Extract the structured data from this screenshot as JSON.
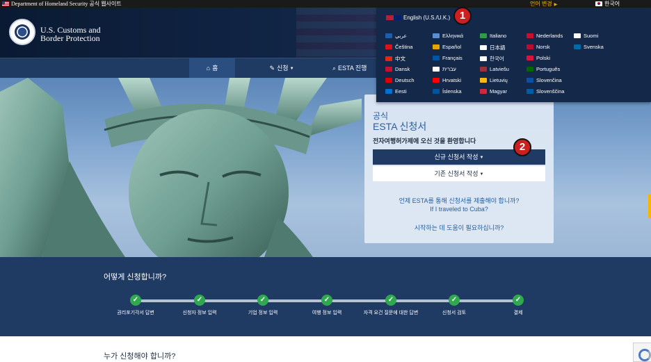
{
  "topbar": {
    "dhs_text": "Department of Homeland Security 공식 웹사이트",
    "language_change": "언어 변경",
    "current_language": "한국어"
  },
  "header": {
    "brand_line1": "U.S. Customs and",
    "brand_line2": "Border Protection"
  },
  "nav": {
    "home": "홈",
    "apply": "신청",
    "esta_status": "ESTA 진행"
  },
  "language_menu": {
    "current": "English (U.S./U.K.)",
    "languages": [
      [
        "عربي",
        "Ελληνικά",
        "Italiano",
        "Nederlands",
        "Suomi"
      ],
      [
        "Čeština",
        "Español",
        "日本語",
        "Norsk",
        "Svenska"
      ],
      [
        "中文",
        "Français",
        "한국어",
        "Polski",
        ""
      ],
      [
        "Dansk",
        "עברית",
        "Latviešu",
        "Português",
        ""
      ],
      [
        "Deutsch",
        "Hrvatski",
        "Lietuvių",
        "Slovenčina",
        ""
      ],
      [
        "Eesti",
        "Íslenska",
        "Magyar",
        "Slovenščina",
        ""
      ]
    ]
  },
  "card": {
    "official": "공식",
    "title": "ESTA 신청서",
    "welcome": "전자여행허가제에 오신 것을 환영합니다",
    "new_application": "신규 신청서 작성",
    "existing_application": "기존 신청서 작성",
    "link_when": "언제 ESTA를 통해 신청서를 제출해야 합니까?",
    "link_cuba": "If I traveled to Cuba?",
    "link_help": "시작하는 데 도움이 필요하십니까?"
  },
  "markers": {
    "one": "1",
    "two": "2"
  },
  "how": {
    "title": "어떻게 신청합니까?",
    "steps": [
      "권리포기각서 답변",
      "신청자 정보 입력",
      "기업 정보 입력",
      "여행 정보 입력",
      "자격 요건 질문에 대한 답변",
      "신청서 검토",
      "결제"
    ]
  },
  "who": {
    "title": "누가 신청해야 합니까?"
  },
  "colors": {
    "navy": "#1f3a63",
    "accent_yellow": "#f5b600",
    "step_green": "#2fa84f",
    "marker_red": "#cc1f1f"
  }
}
